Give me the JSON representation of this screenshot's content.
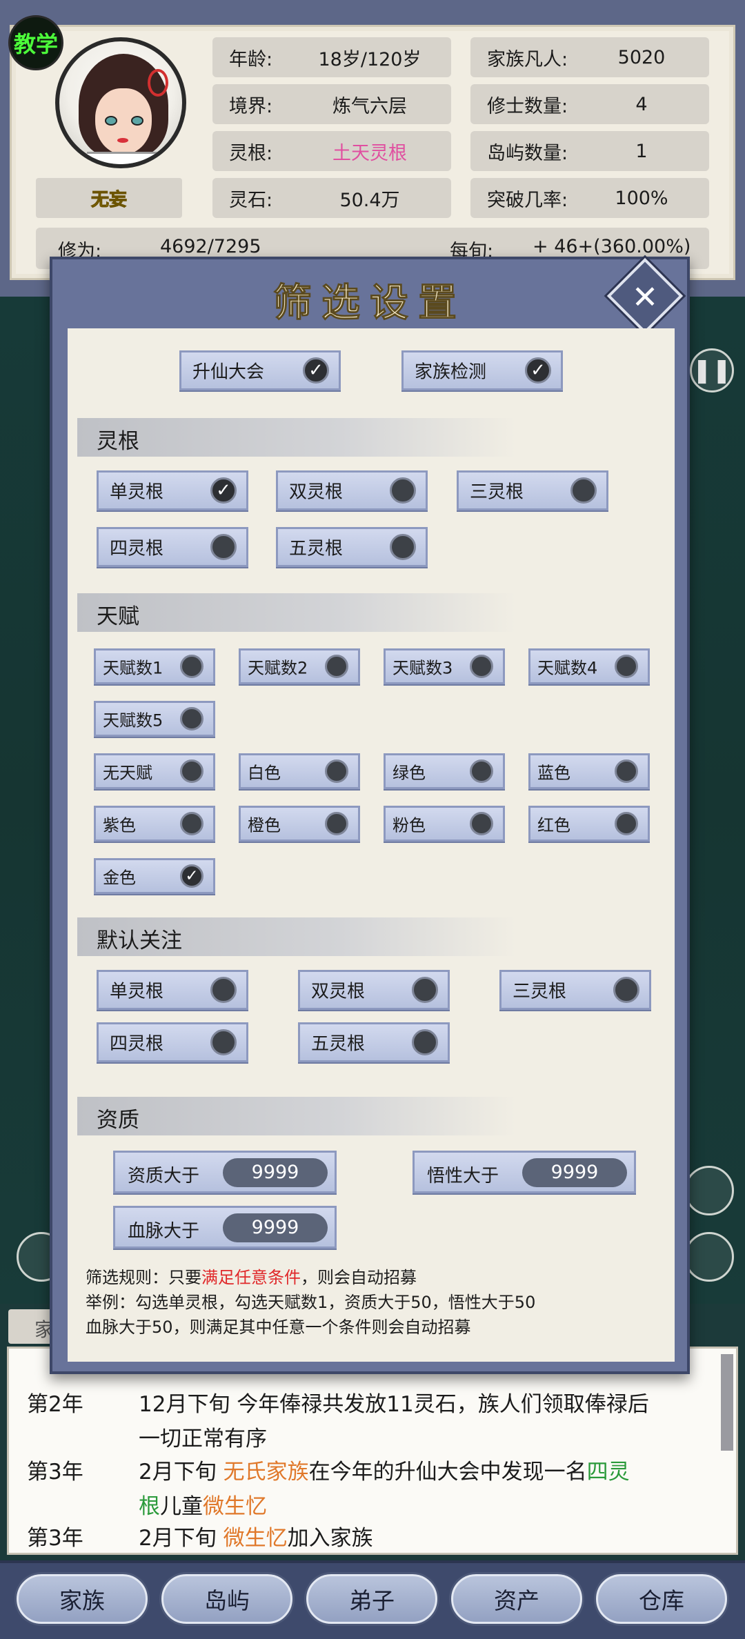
{
  "teach_badge": "教学",
  "player": {
    "name": "无妄"
  },
  "stats_left": [
    {
      "label": "年龄:",
      "value": "18岁/120岁"
    },
    {
      "label": "境界:",
      "value": "炼气六层"
    },
    {
      "label": "灵根:",
      "value": "土天灵根"
    },
    {
      "label": "灵石:",
      "value": "50.4万"
    }
  ],
  "stats_right": [
    {
      "label": "家族凡人:",
      "value": "5020"
    },
    {
      "label": "修士数量:",
      "value": "4"
    },
    {
      "label": "岛屿数量:",
      "value": "1"
    },
    {
      "label": "突破几率:",
      "value": "100%"
    }
  ],
  "cultivation": {
    "label": "修为:",
    "value": "4692/7295",
    "rate_label": "每旬:",
    "rate_value": "+ 46+(360.00%)"
  },
  "colors": {
    "spirit_root": "#e04fa0",
    "accent_red": "#e0282a",
    "log_orange": "#e0782a",
    "log_green": "#2a9a3a"
  },
  "modal": {
    "title": "筛选设置",
    "close_icon": "close-icon",
    "top_toggles": [
      {
        "label": "升仙大会",
        "checked": true
      },
      {
        "label": "家族检测",
        "checked": true
      }
    ],
    "sections": {
      "spirit_root": "灵根",
      "talent": "天赋",
      "default_focus": "默认关注",
      "aptitude": "资质"
    },
    "spirit_root_options": [
      {
        "label": "单灵根",
        "checked": true
      },
      {
        "label": "双灵根",
        "checked": false
      },
      {
        "label": "三灵根",
        "checked": false
      },
      {
        "label": "四灵根",
        "checked": false
      },
      {
        "label": "五灵根",
        "checked": false
      }
    ],
    "talent_options": [
      {
        "label": "天赋数1",
        "checked": false
      },
      {
        "label": "天赋数2",
        "checked": false
      },
      {
        "label": "天赋数3",
        "checked": false
      },
      {
        "label": "天赋数4",
        "checked": false
      },
      {
        "label": "天赋数5",
        "checked": false
      },
      {
        "label": "无天赋",
        "checked": false
      },
      {
        "label": "白色",
        "checked": false
      },
      {
        "label": "绿色",
        "checked": false
      },
      {
        "label": "蓝色",
        "checked": false
      },
      {
        "label": "紫色",
        "checked": false
      },
      {
        "label": "橙色",
        "checked": false
      },
      {
        "label": "粉色",
        "checked": false
      },
      {
        "label": "红色",
        "checked": false
      },
      {
        "label": "金色",
        "checked": true
      }
    ],
    "default_focus_options": [
      {
        "label": "单灵根",
        "checked": false
      },
      {
        "label": "双灵根",
        "checked": false
      },
      {
        "label": "三灵根",
        "checked": false
      },
      {
        "label": "四灵根",
        "checked": false
      },
      {
        "label": "五灵根",
        "checked": false
      }
    ],
    "aptitude_fields": [
      {
        "label": "资质大于",
        "value": "9999"
      },
      {
        "label": "悟性大于",
        "value": "9999"
      },
      {
        "label": "血脉大于",
        "value": "9999"
      }
    ],
    "rules": {
      "line1_prefix": "筛选规则：只要",
      "line1_highlight": "满足任意条件",
      "line1_suffix": "，则会自动招募",
      "line2": "举例：勾选单灵根，勾选天赋数1，资质大于50，悟性大于50",
      "line3": "血脉大于50，则满足其中任意一个条件则会自动招募"
    }
  },
  "log": {
    "tab": "家",
    "entries": [
      {
        "year": "第2年",
        "text_a": "12月下旬 今年俸禄共发放11灵石，族人们领取俸禄后",
        "text_b": "一切正常有序"
      },
      {
        "year": "第3年",
        "text_a_1": "2月下旬 ",
        "family": "无氏家族",
        "text_a_2": "在今年的升仙大会中发现一名",
        "root": "四灵",
        "root_b": "根",
        "text_b_1": "儿童",
        "child": "微生忆"
      },
      {
        "year": "第3年",
        "text_1": "2月下旬 ",
        "child": "微生忆",
        "text_2": "加入家族"
      }
    ]
  },
  "bottom_nav": [
    "家族",
    "岛屿",
    "弟子",
    "资产",
    "仓库"
  ]
}
